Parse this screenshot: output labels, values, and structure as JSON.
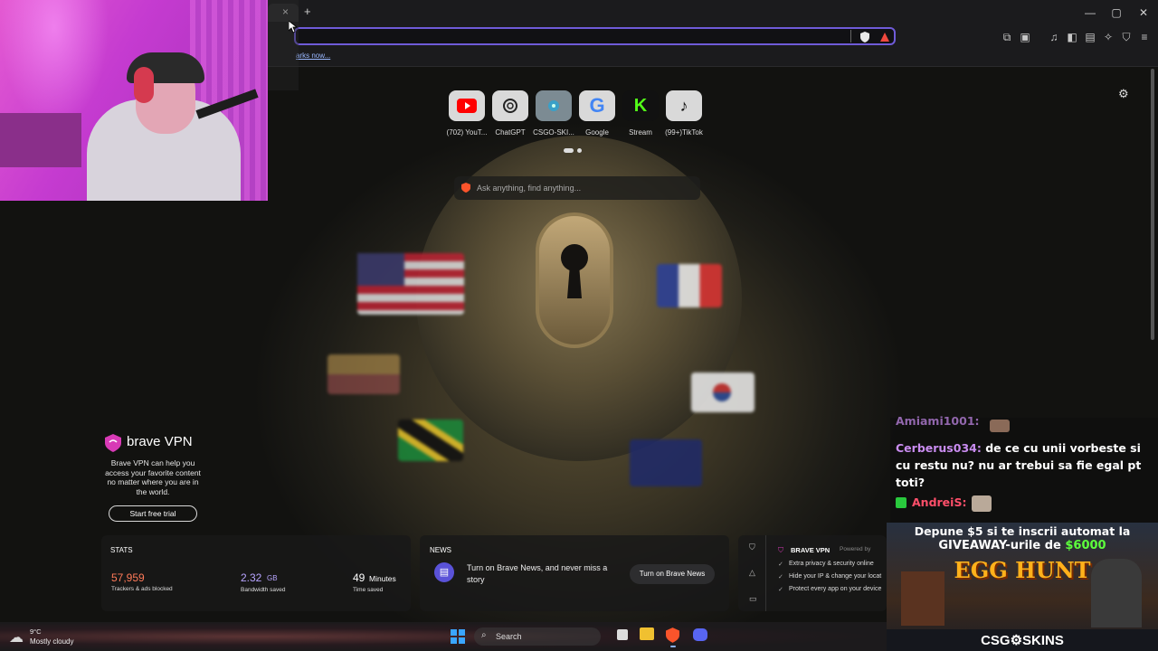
{
  "browser": {
    "tab_close": "×",
    "tab_new": "+",
    "window": {
      "minimize": "—",
      "maximize": "▢",
      "close": "✕"
    },
    "bookmarks_text": "arks now..."
  },
  "top_sites": [
    {
      "label": "(702) YouT...",
      "icon": "youtube-icon",
      "color": "#ff0000"
    },
    {
      "label": "ChatGPT",
      "icon": "chatgpt-icon",
      "color": "#333333"
    },
    {
      "label": "CSGO-SKI...",
      "icon": "csgo-skins-icon",
      "color": "#3aa0c8"
    },
    {
      "label": "Google",
      "icon": "google-icon",
      "color": "#4285f4"
    },
    {
      "label": "Stream",
      "icon": "kick-icon",
      "color": "#53fc18"
    },
    {
      "label": "(99+)TikTok",
      "icon": "tiktok-icon",
      "color": "#111111"
    }
  ],
  "search": {
    "placeholder": "Ask anything, find anything..."
  },
  "vpn_card": {
    "title": "brave VPN",
    "description": "Brave VPN can help you access your favorite content no matter where you are in the world.",
    "button": "Start free trial"
  },
  "stats": {
    "heading": "STATS",
    "trackers_value": "57,959",
    "trackers_label": "Trackers & ads blocked",
    "bandwidth_value": "2.32",
    "bandwidth_unit": "GB",
    "bandwidth_label": "Bandwidth saved",
    "time_value": "49",
    "time_unit": "Minutes",
    "time_label": "Time saved"
  },
  "news": {
    "heading": "NEWS",
    "text": "Turn on Brave News, and never miss a story",
    "button": "Turn on Brave News"
  },
  "vpn_widget": {
    "title": "BRAVE VPN",
    "powered": "Powered by",
    "features": [
      "Extra privacy & security online",
      "Hide your IP & change your locat",
      "Protect every app on your device"
    ]
  },
  "chat": [
    {
      "user": "Amiami1001:",
      "color": "#c98cf0",
      "text": ""
    },
    {
      "user": "Cerberus034:",
      "color": "#c98cf0",
      "text": "de ce cu unii vorbeste si cu restu nu? nu ar trebui sa fie egal pt toti?"
    },
    {
      "user": "AndreiS:",
      "color": "#ff4f6a",
      "text": ""
    }
  ],
  "promo": {
    "line1": "Depune $5 si te inscrii automat la",
    "line2a": "GIVEAWAY-urile de ",
    "line2b": "$6000",
    "event": "EGG HUNT",
    "brand": "CSG⚙SKINS"
  },
  "taskbar": {
    "weather_temp": "9°C",
    "weather_desc": "Mostly cloudy",
    "search_label": "Search"
  }
}
